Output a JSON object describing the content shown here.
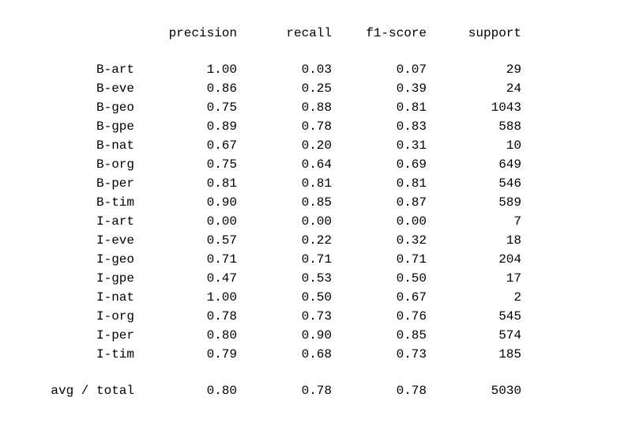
{
  "chart_data": {
    "type": "table",
    "title": "",
    "columns": [
      "label",
      "precision",
      "recall",
      "f1-score",
      "support"
    ],
    "rows": [
      {
        "label": "B-art",
        "precision": "1.00",
        "recall": "0.03",
        "f1": "0.07",
        "support": "29"
      },
      {
        "label": "B-eve",
        "precision": "0.86",
        "recall": "0.25",
        "f1": "0.39",
        "support": "24"
      },
      {
        "label": "B-geo",
        "precision": "0.75",
        "recall": "0.88",
        "f1": "0.81",
        "support": "1043"
      },
      {
        "label": "B-gpe",
        "precision": "0.89",
        "recall": "0.78",
        "f1": "0.83",
        "support": "588"
      },
      {
        "label": "B-nat",
        "precision": "0.67",
        "recall": "0.20",
        "f1": "0.31",
        "support": "10"
      },
      {
        "label": "B-org",
        "precision": "0.75",
        "recall": "0.64",
        "f1": "0.69",
        "support": "649"
      },
      {
        "label": "B-per",
        "precision": "0.81",
        "recall": "0.81",
        "f1": "0.81",
        "support": "546"
      },
      {
        "label": "B-tim",
        "precision": "0.90",
        "recall": "0.85",
        "f1": "0.87",
        "support": "589"
      },
      {
        "label": "I-art",
        "precision": "0.00",
        "recall": "0.00",
        "f1": "0.00",
        "support": "7"
      },
      {
        "label": "I-eve",
        "precision": "0.57",
        "recall": "0.22",
        "f1": "0.32",
        "support": "18"
      },
      {
        "label": "I-geo",
        "precision": "0.71",
        "recall": "0.71",
        "f1": "0.71",
        "support": "204"
      },
      {
        "label": "I-gpe",
        "precision": "0.47",
        "recall": "0.53",
        "f1": "0.50",
        "support": "17"
      },
      {
        "label": "I-nat",
        "precision": "1.00",
        "recall": "0.50",
        "f1": "0.67",
        "support": "2"
      },
      {
        "label": "I-org",
        "precision": "0.78",
        "recall": "0.73",
        "f1": "0.76",
        "support": "545"
      },
      {
        "label": "I-per",
        "precision": "0.80",
        "recall": "0.90",
        "f1": "0.85",
        "support": "574"
      },
      {
        "label": "I-tim",
        "precision": "0.79",
        "recall": "0.68",
        "f1": "0.73",
        "support": "185"
      }
    ],
    "summary": {
      "label": "avg / total",
      "precision": "0.80",
      "recall": "0.78",
      "f1": "0.78",
      "support": "5030"
    }
  },
  "headers": {
    "precision": "precision",
    "recall": "recall",
    "f1": "f1-score",
    "support": "support"
  }
}
